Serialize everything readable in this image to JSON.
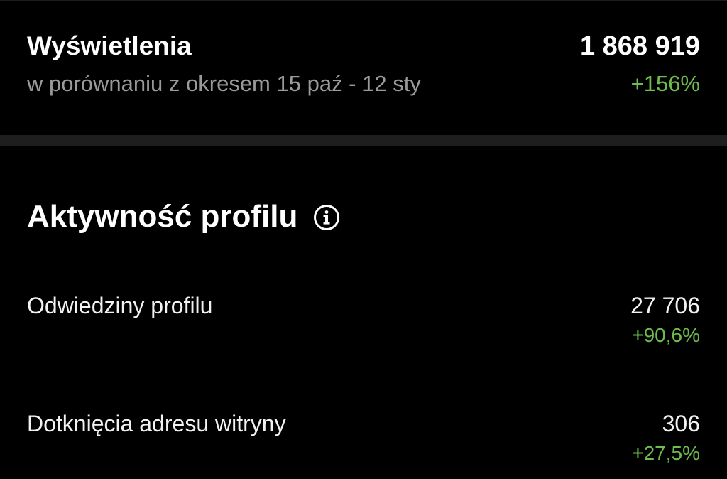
{
  "views": {
    "title": "Wyświetlenia",
    "comparison": "w porównaniu z okresem 15 paź - 12 sty",
    "value": "1 868 919",
    "change": "+156%"
  },
  "profile_activity": {
    "title": "Aktywność profilu",
    "info_icon": "info-icon",
    "metrics": [
      {
        "label": "Odwiedziny profilu",
        "value": "27 706",
        "change": "+90,6%"
      },
      {
        "label": "Dotknięcia adresu witryny",
        "value": "306",
        "change": "+27,5%"
      }
    ]
  },
  "colors": {
    "background": "#000000",
    "positive_change": "#6dbd4e",
    "secondary_text": "#9a9a9a",
    "divider": "#1e1e1e"
  }
}
